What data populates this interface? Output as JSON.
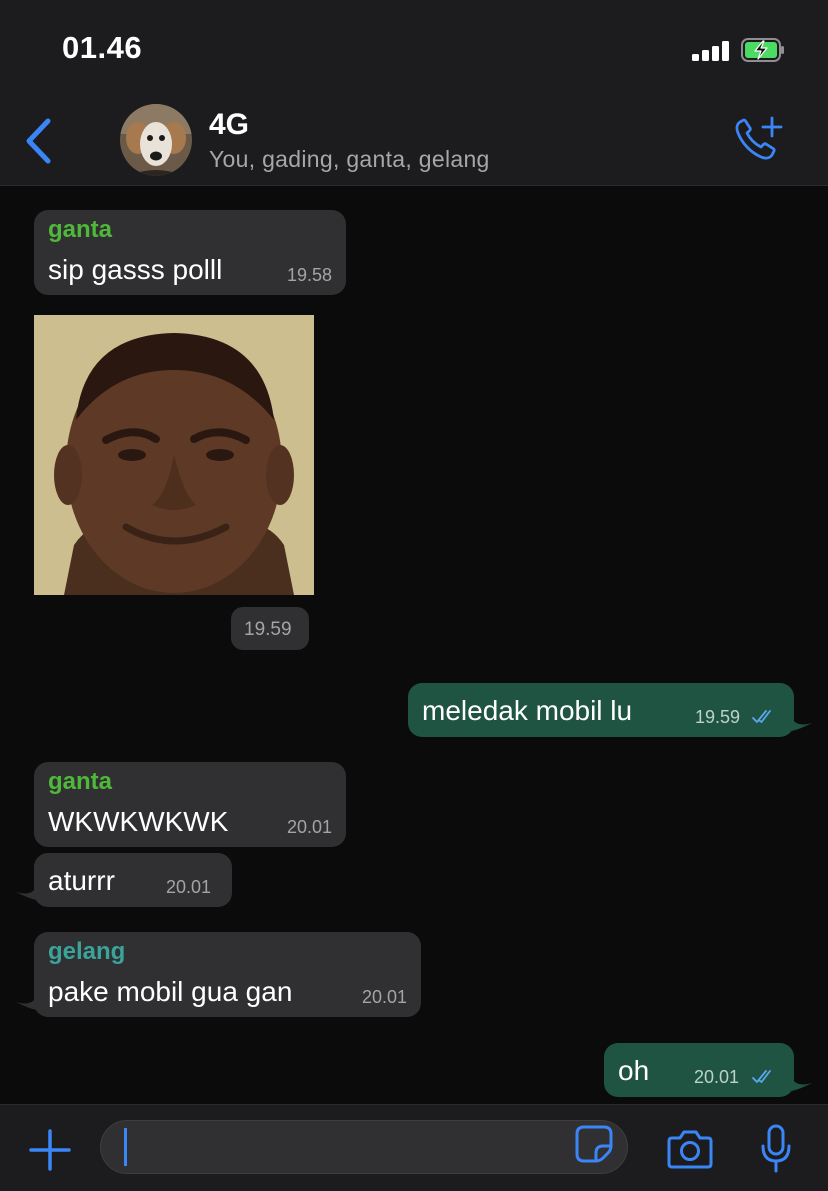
{
  "status_bar": {
    "time": "01.46"
  },
  "header": {
    "title": "4G",
    "members": "You, gading, ganta, gelang",
    "icons": {
      "back": "chevron-left-icon",
      "call": "phone-plus-icon"
    },
    "accent": "#3a86f7"
  },
  "messages": [
    {
      "type": "text",
      "direction": "in",
      "sender": "ganta",
      "text": "sip gasss polll",
      "time": "19.58"
    },
    {
      "type": "image",
      "direction": "in",
      "time": "19.59"
    },
    {
      "type": "text",
      "direction": "out",
      "text": "meledak mobil lu",
      "time": "19.59",
      "read": true
    },
    {
      "type": "text",
      "direction": "in",
      "sender": "ganta",
      "text": "WKWKWKWK",
      "time": "20.01"
    },
    {
      "type": "text",
      "direction": "in",
      "text": "aturrr",
      "time": "20.01"
    },
    {
      "type": "text",
      "direction": "in",
      "sender": "gelang",
      "text": "pake mobil gua gan",
      "time": "20.01"
    },
    {
      "type": "text",
      "direction": "out",
      "text": "oh",
      "time": "20.01",
      "read": true
    }
  ],
  "sender_colors": {
    "ganta": "#4fb83a",
    "gelang": "#3aa39a"
  },
  "composer": {
    "value": "",
    "icons": [
      "plus-icon",
      "sticker-icon",
      "camera-icon",
      "microphone-icon"
    ]
  },
  "colors": {
    "incoming_bubble": "#303032",
    "outgoing_bubble": "#1f5443",
    "background": "#0b0b0b",
    "read_ticks": "#5aa7ee"
  }
}
